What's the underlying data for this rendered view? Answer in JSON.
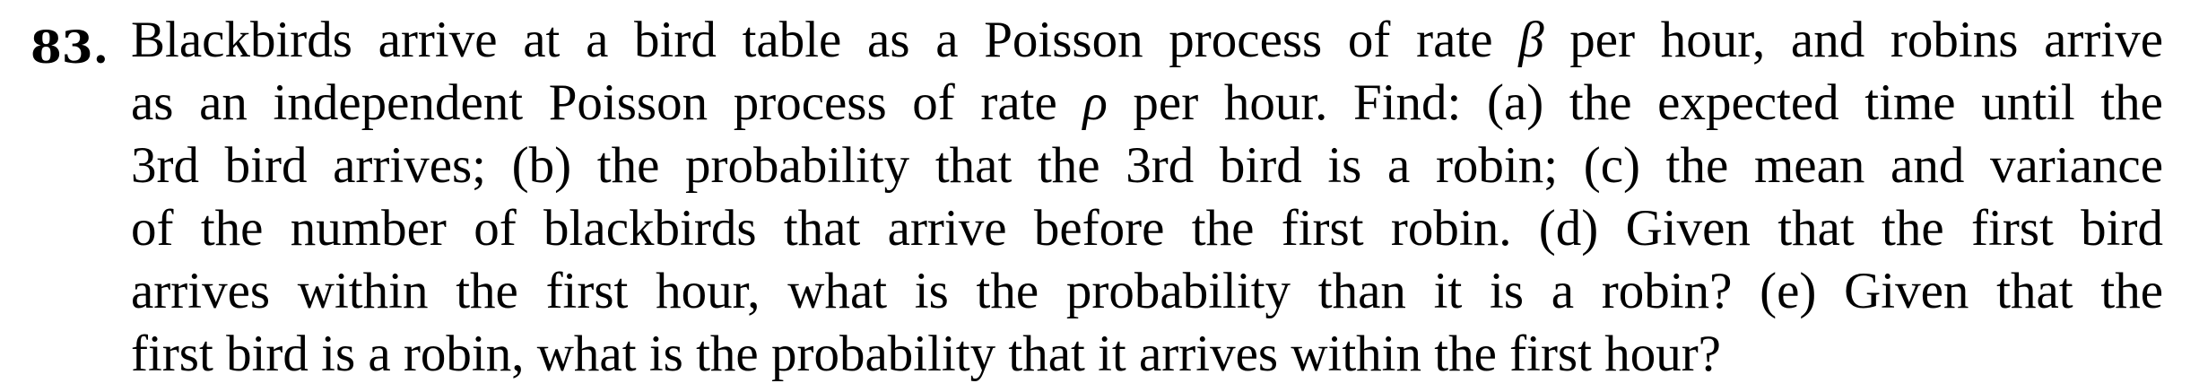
{
  "problem": {
    "number": "83.",
    "lines": [
      {
        "before": "Blackbirds arrive at a bird table as a Poisson process of rate ",
        "var": "β",
        "after": " per hour, and robins arrive"
      },
      {
        "before": "as an independent Poisson process of rate ",
        "var": "ρ",
        "after": " per hour. Find: (a) the expected time until the"
      },
      {
        "text": "3rd bird arrives; (b) the probability that the 3rd bird is a robin; (c) the mean and variance"
      },
      {
        "text": "of the number of blackbirds that arrive before the first robin. (d) Given that the first bird"
      },
      {
        "text": "arrives within the first hour, what is the probability than it is a robin? (e) Given that the"
      },
      {
        "text": "first bird is a robin, what is the probability that it arrives within the first hour?"
      }
    ]
  }
}
